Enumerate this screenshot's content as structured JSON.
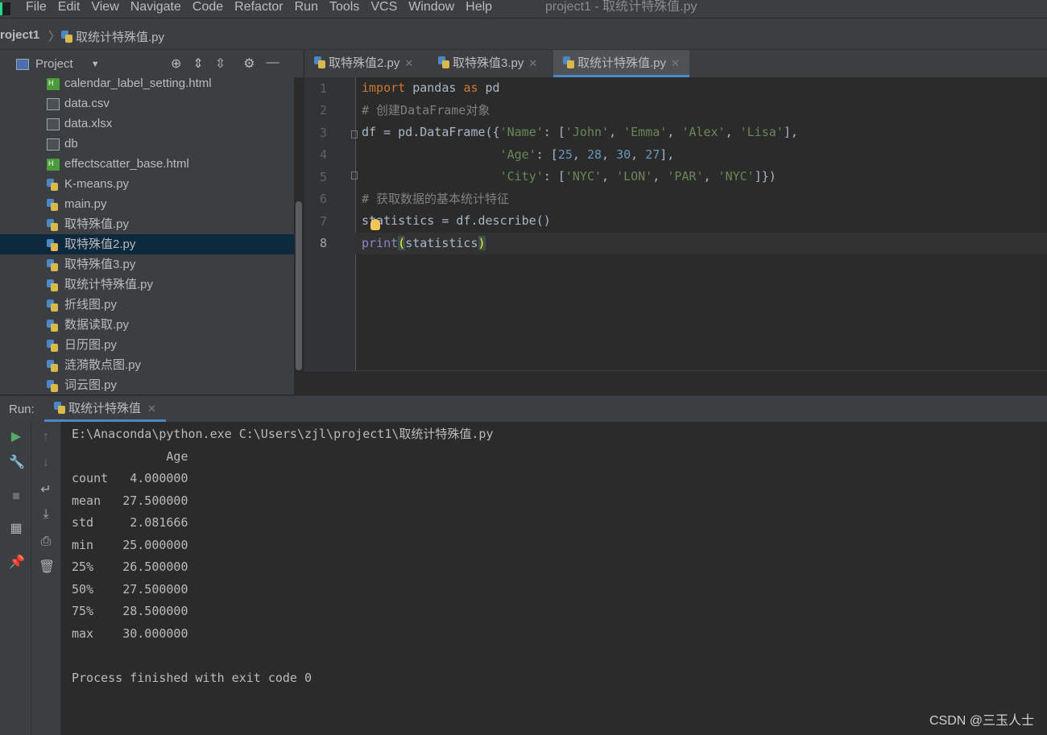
{
  "menubar": {
    "items": [
      "File",
      "Edit",
      "View",
      "Navigate",
      "Code",
      "Refactor",
      "Run",
      "Tools",
      "VCS",
      "Window",
      "Help"
    ],
    "title": "project1 - 取统计特殊值.py"
  },
  "navbar": {
    "project": "roject1",
    "file": "取统计特殊值.py"
  },
  "project_panel": {
    "label": "Project",
    "files": [
      {
        "name": "calendar_label_setting.html",
        "icon": "html-icon"
      },
      {
        "name": "data.csv",
        "icon": "file-icon"
      },
      {
        "name": "data.xlsx",
        "icon": "file-icon"
      },
      {
        "name": "db",
        "icon": "file-icon"
      },
      {
        "name": "effectscatter_base.html",
        "icon": "html-icon"
      },
      {
        "name": "K-means.py",
        "icon": "python-icon"
      },
      {
        "name": "main.py",
        "icon": "python-icon"
      },
      {
        "name": "取特殊值.py",
        "icon": "python-icon"
      },
      {
        "name": "取特殊值2.py",
        "icon": "python-icon",
        "selected": true
      },
      {
        "name": "取特殊值3.py",
        "icon": "python-icon"
      },
      {
        "name": "取统计特殊值.py",
        "icon": "python-icon"
      },
      {
        "name": "折线图.py",
        "icon": "python-icon"
      },
      {
        "name": "数据读取.py",
        "icon": "python-icon"
      },
      {
        "name": "日历图.py",
        "icon": "python-icon"
      },
      {
        "name": "涟漪散点图.py",
        "icon": "python-icon"
      },
      {
        "name": "词云图.py",
        "icon": "python-icon"
      }
    ]
  },
  "editor_tabs": [
    {
      "label": "取特殊值2.py",
      "active": false
    },
    {
      "label": "取特殊值3.py",
      "active": false
    },
    {
      "label": "取统计特殊值.py",
      "active": true
    }
  ],
  "editor": {
    "line_numbers": [
      "1",
      "2",
      "3",
      "4",
      "5",
      "6",
      "7",
      "8"
    ],
    "current_line": 8
  },
  "run_panel": {
    "label": "Run:",
    "tab": "取统计特殊值",
    "output": [
      "E:\\Anaconda\\python.exe C:\\Users\\zjl\\project1\\取统计特殊值.py",
      "             Age",
      "count   4.000000",
      "mean   27.500000",
      "std     2.081666",
      "min    25.000000",
      "25%    26.500000",
      "50%    27.500000",
      "75%    28.500000",
      "max    30.000000",
      "",
      "Process finished with exit code 0"
    ]
  },
  "watermark": "CSDN @三玉人士",
  "colors": {
    "background": "#2b2b2b",
    "panel": "#3c3f41",
    "keyword": "#cc7832",
    "string": "#6a8759",
    "number": "#6897bb",
    "comment": "#808080",
    "selection": "#0d293e",
    "accent": "#4a88c7"
  }
}
